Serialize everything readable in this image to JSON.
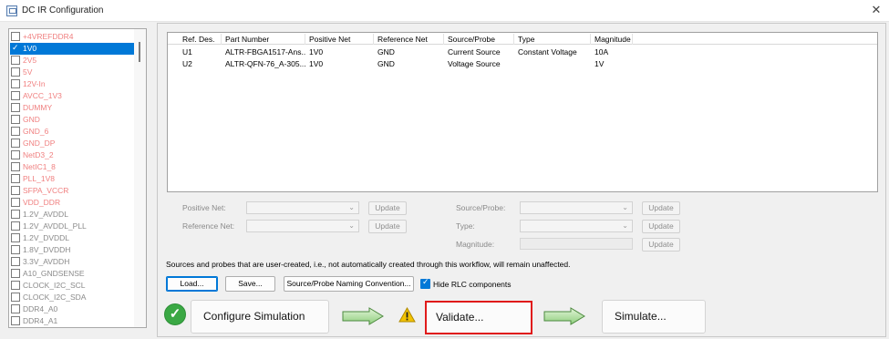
{
  "window": {
    "title": "DC IR Configuration",
    "close_glyph": "✕"
  },
  "net_list": [
    {
      "label": "+4VREFDDR4",
      "checked": false,
      "selected": false,
      "color": "#f08080"
    },
    {
      "label": "1V0",
      "checked": true,
      "selected": true,
      "color": "#ffffff"
    },
    {
      "label": "2V5",
      "checked": false,
      "selected": false,
      "color": "#f08080"
    },
    {
      "label": "5V",
      "checked": false,
      "selected": false,
      "color": "#f08080"
    },
    {
      "label": "12V-In",
      "checked": false,
      "selected": false,
      "color": "#f08080"
    },
    {
      "label": "AVCC_1V3",
      "checked": false,
      "selected": false,
      "color": "#f08080"
    },
    {
      "label": "DUMMY",
      "checked": false,
      "selected": false,
      "color": "#f08080"
    },
    {
      "label": "GND",
      "checked": false,
      "selected": false,
      "color": "#f08080"
    },
    {
      "label": "GND_6",
      "checked": false,
      "selected": false,
      "color": "#f08080"
    },
    {
      "label": "GND_DP",
      "checked": false,
      "selected": false,
      "color": "#f08080"
    },
    {
      "label": "NetD3_2",
      "checked": false,
      "selected": false,
      "color": "#f08080"
    },
    {
      "label": "NetIC1_8",
      "checked": false,
      "selected": false,
      "color": "#f08080"
    },
    {
      "label": "PLL_1V8",
      "checked": false,
      "selected": false,
      "color": "#f08080"
    },
    {
      "label": "SFPA_VCCR",
      "checked": false,
      "selected": false,
      "color": "#f08080"
    },
    {
      "label": "VDD_DDR",
      "checked": false,
      "selected": false,
      "color": "#f08080"
    },
    {
      "label": "1.2V_AVDDL",
      "checked": false,
      "selected": false,
      "color": "#8a8a8a"
    },
    {
      "label": "1.2V_AVDDL_PLL",
      "checked": false,
      "selected": false,
      "color": "#8a8a8a"
    },
    {
      "label": "1.2V_DVDDL",
      "checked": false,
      "selected": false,
      "color": "#8a8a8a"
    },
    {
      "label": "1.8V_DVDDH",
      "checked": false,
      "selected": false,
      "color": "#8a8a8a"
    },
    {
      "label": "3.3V_AVDDH",
      "checked": false,
      "selected": false,
      "color": "#8a8a8a"
    },
    {
      "label": "A10_GNDSENSE",
      "checked": false,
      "selected": false,
      "color": "#8a8a8a"
    },
    {
      "label": "CLOCK_I2C_SCL",
      "checked": false,
      "selected": false,
      "color": "#8a8a8a"
    },
    {
      "label": "CLOCK_I2C_SDA",
      "checked": false,
      "selected": false,
      "color": "#8a8a8a"
    },
    {
      "label": "DDR4_A0",
      "checked": false,
      "selected": false,
      "color": "#8a8a8a"
    },
    {
      "label": "DDR4_A1",
      "checked": false,
      "selected": false,
      "color": "#8a8a8a"
    }
  ],
  "table": {
    "headers": [
      "Ref. Des.",
      "Part Number",
      "Positive Net",
      "Reference Net",
      "Source/Probe",
      "Type",
      "Magnitude"
    ],
    "rows": [
      [
        "U1",
        "ALTR-FBGA1517-Ans...",
        "1V0",
        "GND",
        "Current Source",
        "Constant Voltage",
        "10A"
      ],
      [
        "U2",
        "ALTR-QFN-76_A-305...",
        "1V0",
        "GND",
        "Voltage Source",
        "",
        "1V"
      ]
    ]
  },
  "form": {
    "positive_net_label": "Positive Net:",
    "reference_net_label": "Reference Net:",
    "source_probe_label": "Source/Probe:",
    "type_label": "Type:",
    "magnitude_label": "Magnitude:",
    "update_label": "Update"
  },
  "note": "Sources and probes that are user-created, i.e., not automatically created through this workflow, will remain unaffected.",
  "actions": {
    "load": "Load...",
    "save": "Save...",
    "naming": "Source/Probe Naming Convention...",
    "hide_rlc": "Hide RLC components",
    "hide_rlc_checked": true
  },
  "workflow": {
    "configure": "Configure Simulation",
    "configure_status": "complete",
    "validate": "Validate...",
    "validate_status": "warning",
    "simulate": "Simulate..."
  },
  "colors": {
    "selection": "#0078d7",
    "highlight_border": "#e01a1a",
    "ok_green": "#3aa844",
    "warn_yellow": "#f2c200"
  }
}
